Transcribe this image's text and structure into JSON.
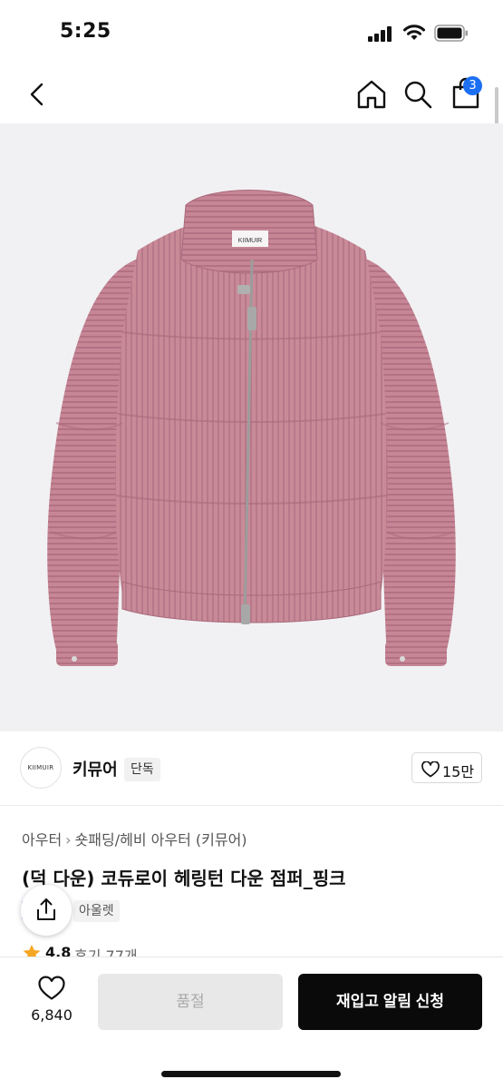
{
  "status_bar": {
    "time": "5:25",
    "icons": [
      "signal-icon",
      "wifi-icon",
      "battery-icon"
    ]
  },
  "nav": {
    "back_icon": "chevron-left-icon",
    "home_icon": "home-icon",
    "search_icon": "search-icon",
    "cart_icon": "shopping-bag-icon",
    "cart_badge": "3",
    "badge_color": "#1d6ff2"
  },
  "product_image": {
    "description_icon": "jacket-image",
    "brand_tag": "KIIMUIR",
    "jacket_color": "#c98a98"
  },
  "brand": {
    "logo_text": "KIIMUIR",
    "name": "키뮤어",
    "badge": "단독",
    "like_count": "15만"
  },
  "product": {
    "breadcrumb": [
      "아우터",
      "숏패딩/헤비 아우터 (키뮤어)"
    ],
    "title": "(덕 다운) 코듀로이 헤링턴 다운 점퍼_핑크",
    "outlet_label": "아울렛",
    "rating": "4.8",
    "reviews": "후기 77개",
    "star_color": "#f5a623"
  },
  "bottom_bar": {
    "wish_count": "6,840",
    "soldout_label": "품절",
    "restock_label": "재입고 알림 신청"
  }
}
